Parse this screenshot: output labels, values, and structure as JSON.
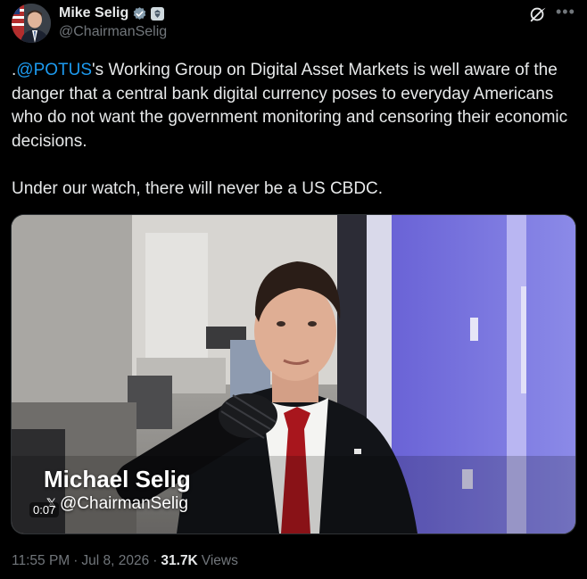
{
  "author": {
    "display_name": "Mike Selig",
    "handle": "@ChairmanSelig"
  },
  "tweet": {
    "mention": "@POTUS",
    "text_prefix": ".",
    "text_rest": "'s Working Group on Digital Asset Markets is well aware of the danger that a central bank digital currency poses to everyday Americans who do not want the government monitoring and censoring their economic decisions.\n\nUnder our watch, there will never be a US CBDC."
  },
  "video": {
    "overlay_name": "Michael Selig",
    "overlay_handle": "@ChairmanSelig",
    "timestamp": "0:07"
  },
  "meta": {
    "time": "11:55 PM",
    "date": "Jul 8, 2026",
    "views_count": "31.7K",
    "views_label": "Views"
  },
  "icons": {
    "verified": "verified-badge-icon",
    "gov_badge": "government-badge-icon",
    "grok": "grok-icon",
    "more": "more-options-icon"
  },
  "colors": {
    "accent": "#1d9bf0",
    "background": "#000000",
    "text": "#e7e9ea",
    "muted": "#71767b"
  }
}
